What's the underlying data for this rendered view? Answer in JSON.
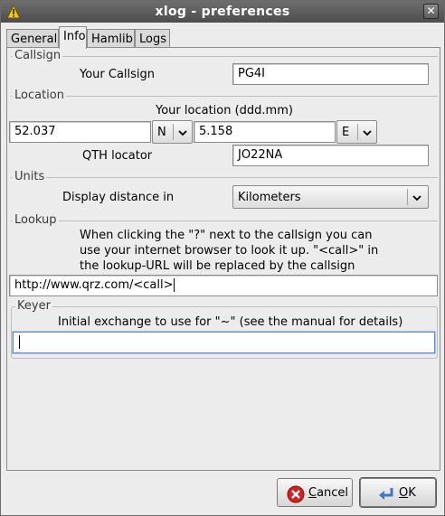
{
  "window": {
    "title": "xlog - preferences"
  },
  "titlebar": {
    "app_icon": "warning-triangle-icon",
    "close_glyph": "✕"
  },
  "tabs": [
    {
      "label": "General"
    },
    {
      "label": "Info",
      "active": true
    },
    {
      "label": "Hamlib"
    },
    {
      "label": "Logs"
    }
  ],
  "callsign": {
    "group_label": "Callsign",
    "label": "Your Callsign",
    "value": "PG4I"
  },
  "location": {
    "group_label": "Location",
    "label": "Your location (ddd.mm)",
    "latitude": "52.037",
    "lat_dir": "N",
    "longitude": "5.158",
    "lon_dir": "E",
    "qth_label": "QTH locator",
    "qth_value": "JO22NA"
  },
  "units": {
    "group_label": "Units",
    "label": "Display distance in",
    "value": "Kilometers"
  },
  "lookup": {
    "group_label": "Lookup",
    "line1": "When clicking the \"?\" next to the callsign you can",
    "line2": "use your internet browser to look it up. \"<call>\" in",
    "line3": "the lookup-URL will be replaced by the callsign",
    "url": "http://www.qrz.com/<call>"
  },
  "keyer": {
    "group_label": "Keyer",
    "label": "Initial exchange to use for \"~\" (see the manual for details)",
    "value": ""
  },
  "buttons": {
    "cancel_mnemonic": "C",
    "cancel_rest": "ancel",
    "ok_mnemonic": "O",
    "ok_rest": "K"
  },
  "colors": {
    "titlebar": "#5c5c5c",
    "window_bg": "#ececec",
    "focus_border": "#5b8fc7",
    "cancel_icon": "#d42020",
    "ok_icon": "#3f78c8"
  }
}
